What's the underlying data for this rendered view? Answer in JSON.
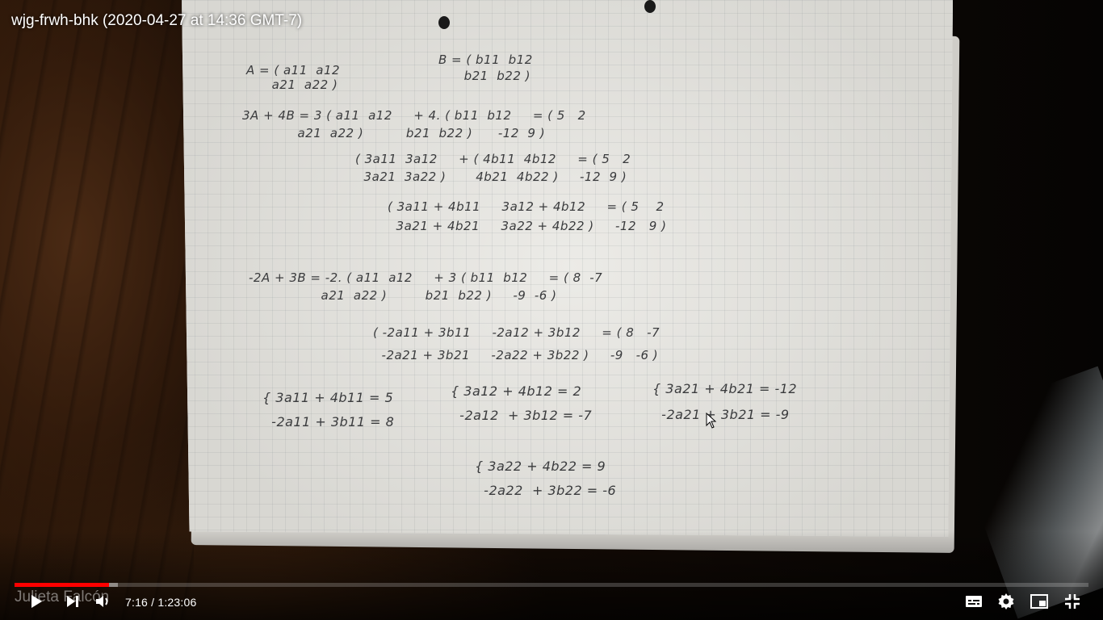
{
  "video": {
    "title": "wjg-frwh-bhk (2020-04-27 at 14:36 GMT-7)",
    "channel_watermark": "Julieta Falcón",
    "current_time": "7:16",
    "duration": "1:23:06",
    "time_separator": "/",
    "progress_fraction": 0.088,
    "buffered_fraction": 0.096,
    "accent_color": "#ff0000"
  },
  "notes": {
    "row1_a": "A = ( a11  a12\n      a21  a22 )",
    "row1_b": "B = ( b11  b12\n      b21  b22 )",
    "row2_lhs": "3A + 4B = 3 ( a11  a12     + 4. ( b11  b12     = ( 5   2\n             a21  a22 )          b21  b22 )      -12  9 )",
    "row3": "( 3a11  3a12     + ( 4b11  4b12     = ( 5   2\n  3a21  3a22 )       4b21  4b22 )     -12  9 )",
    "row4": "( 3a11 + 4b11     3a12 + 4b12     = ( 5    2\n  3a21 + 4b21     3a22 + 4b22 )     -12   9 )",
    "row5": "-2A + 3B = -2. ( a11  a12     + 3 ( b11  b12     = ( 8  -7\n                 a21  a22 )         b21  b22 )     -9  -6 )",
    "row6": "( -2a11 + 3b11     -2a12 + 3b12     = ( 8   -7\n  -2a21 + 3b21     -2a22 + 3b22 )     -9   -6 )",
    "sys1": "{ 3a11 + 4b11 = 5\n  -2a11 + 3b11 = 8",
    "sys2": "{ 3a12 + 4b12 = 2\n  -2a12  + 3b12 = -7",
    "sys3": "{ 3a21 + 4b21 = -12\n  -2a21 + 3b21 = -9",
    "sys4": "{ 3a22 + 4b22 = 9\n  -2a22  + 3b22 = -6"
  },
  "controls": {
    "play_icon": "play-icon",
    "next_icon": "next-icon",
    "volume_icon": "volume-icon",
    "subtitles_icon": "subtitles-icon",
    "settings_icon": "gear-icon",
    "miniplayer_icon": "miniplayer-icon",
    "exit_fullscreen_icon": "exit-fullscreen-icon"
  }
}
